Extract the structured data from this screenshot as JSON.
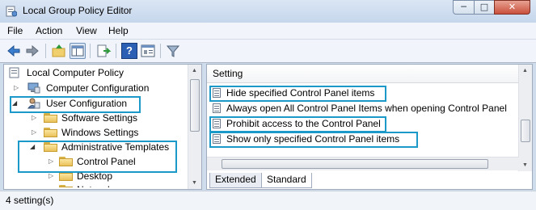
{
  "window": {
    "title": "Local Group Policy Editor",
    "minimize_glyph": "─",
    "maximize_glyph": "□",
    "close_glyph": "✕",
    "app_icon": "policy-editor-icon"
  },
  "menu": {
    "file": "File",
    "action": "Action",
    "view": "View",
    "help": "Help"
  },
  "toolbar": {
    "icons": [
      "back-icon",
      "forward-icon",
      "up-folder-icon",
      "show-hide-tree-icon",
      "export-list-icon",
      "help-icon",
      "extended-view-icon",
      "filter-icon"
    ],
    "help_glyph": "?"
  },
  "tree": {
    "root": "Local Computer Policy",
    "computer_config": "Computer Configuration",
    "user_config": "User Configuration",
    "software_settings": "Software Settings",
    "windows_settings": "Windows Settings",
    "admin_templates": "Administrative Templates",
    "control_panel": "Control Panel",
    "desktop": "Desktop",
    "network": "Network",
    "expand_glyph": "▷",
    "expanded_glyph": "◢"
  },
  "list": {
    "column_header": "Setting",
    "settings": [
      "Hide specified Control Panel items",
      "Always open All Control Panel Items when opening Control Panel",
      "Prohibit access to the Control Panel",
      "Show only specified Control Panel items"
    ]
  },
  "tabs": {
    "extended": "Extended",
    "standard": "Standard"
  },
  "status": {
    "text": "4 setting(s)"
  },
  "colors": {
    "highlight_box": "#1b9ac9",
    "titlebar": "#dbe6f4",
    "close_button": "#c9503c"
  }
}
